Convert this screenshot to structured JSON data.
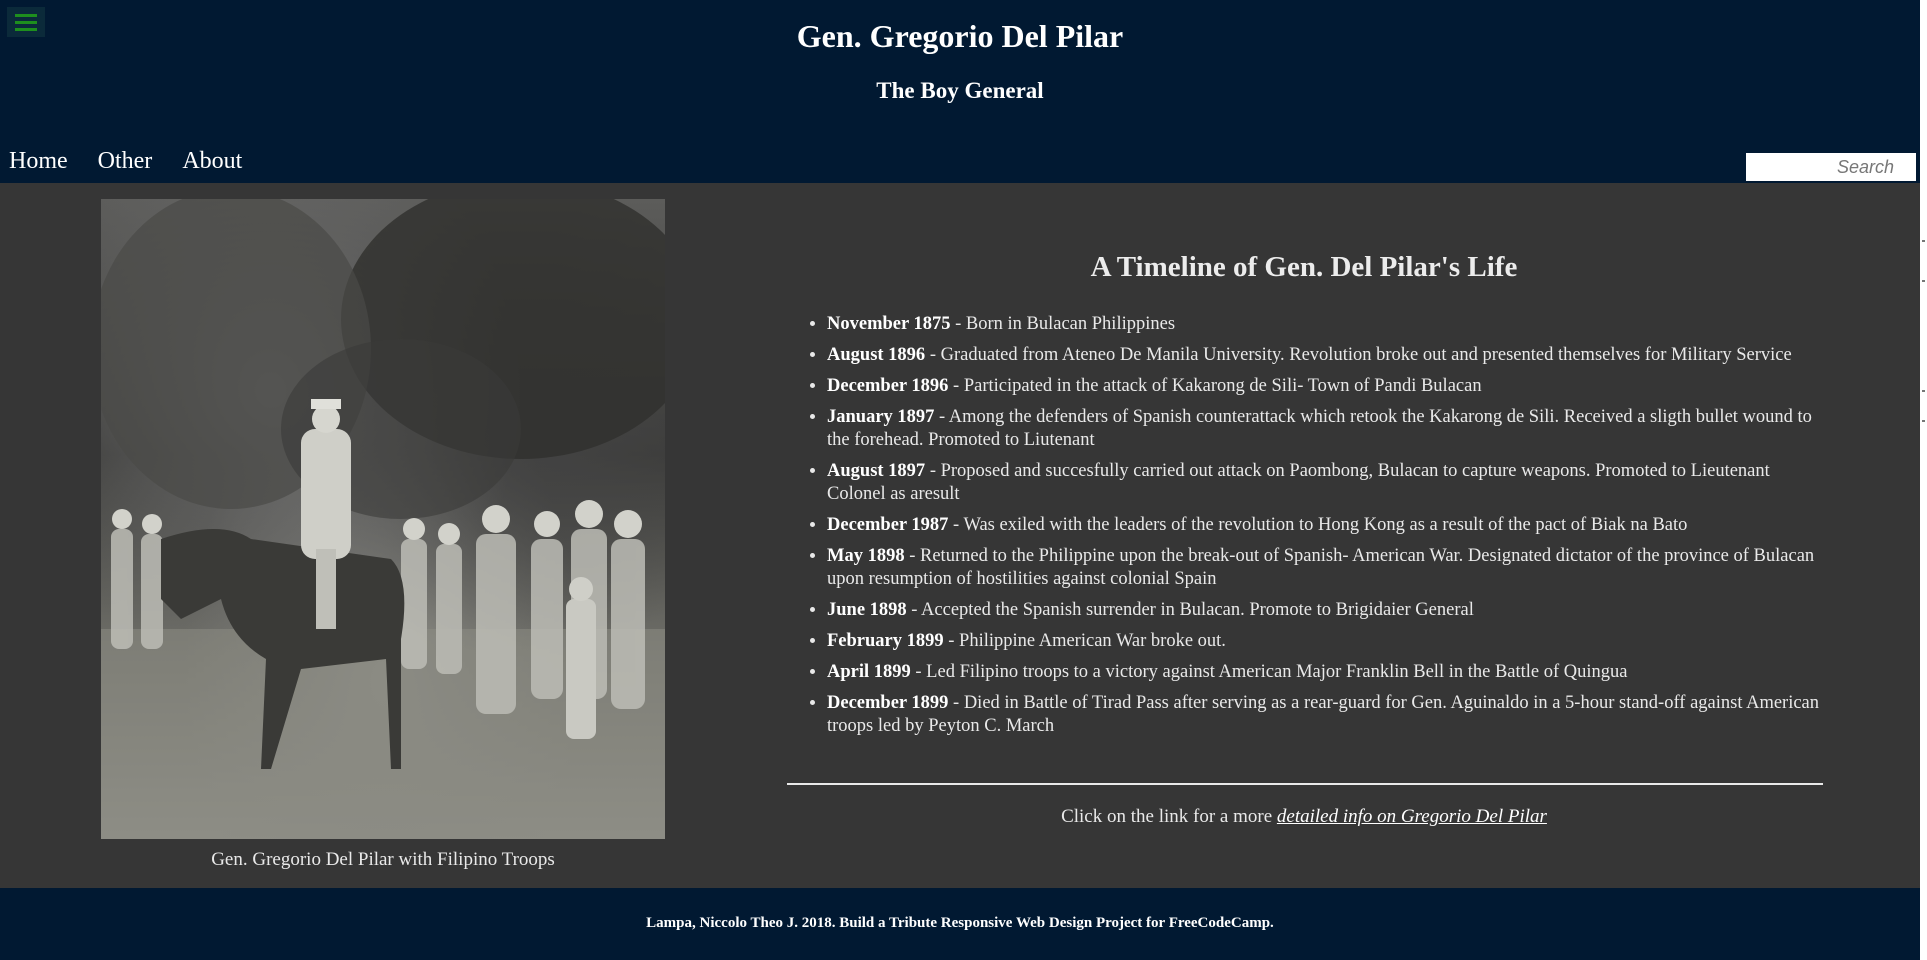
{
  "header": {
    "menu_icon": "hamburger-icon",
    "title": "Gen. Gregorio Del Pilar",
    "subtitle": "The Boy General",
    "nav": [
      {
        "label": "Home"
      },
      {
        "label": "Other"
      },
      {
        "label": "About"
      }
    ],
    "search_placeholder": "Search"
  },
  "main": {
    "photo_caption": "Gen. Gregorio Del Pilar with Filipino Troops",
    "timeline_title": "A Timeline of Gen. Del Pilar's Life",
    "timeline": [
      {
        "date": "November 1875",
        "text": " - Born in Bulacan Philippines"
      },
      {
        "date": "August 1896",
        "text": " - Graduated from Ateneo De Manila University. Revolution broke out and presented themselves for Military Service"
      },
      {
        "date": "December 1896",
        "text": " - Participated in the attack of Kakarong de Sili- Town of Pandi Bulacan"
      },
      {
        "date": "January 1897",
        "text": " - Among the defenders of Spanish counterattack which retook the Kakarong de Sili. Received a sligth bullet wound to the forehead. Promoted to Liutenant"
      },
      {
        "date": "August 1897",
        "text": " - Proposed and succesfully carried out attack on Paombong, Bulacan to capture weapons. Promoted to Lieutenant Colonel as aresult"
      },
      {
        "date": "December 1987",
        "text": " - Was exiled with the leaders of the revolution to Hong Kong as a result of the pact of Biak na Bato"
      },
      {
        "date": "May 1898",
        "text": " - Returned to the Philippine upon the break-out of Spanish- American War. Designated dictator of the province of Bulacan upon resumption of hostilities against colonial Spain"
      },
      {
        "date": "June 1898",
        "text": " - Accepted the Spanish surrender in Bulacan. Promote to Brigidaier General"
      },
      {
        "date": "February 1899",
        "text": " - Philippine American War broke out."
      },
      {
        "date": "April 1899",
        "text": " - Led Filipino troops to a victory against American Major Franklin Bell in the Battle of Quingua"
      },
      {
        "date": "December 1899",
        "text": " - Died in Battle of Tirad Pass after serving as a rear-guard for Gen. Aguinaldo in a 5-hour stand-off against American troops led by Peyton C. March"
      }
    ],
    "more_prefix": "Click on the link for a more ",
    "more_link": "detailed info on Gregorio Del Pilar"
  },
  "footer": {
    "text": "Lampa, Niccolo Theo J. 2018. Build a Tribute Responsive Web Design Project for FreeCodeCamp."
  },
  "colors": {
    "header_bg": "#011932",
    "main_bg": "#363636",
    "menu_icon": "#1e8f1e"
  }
}
